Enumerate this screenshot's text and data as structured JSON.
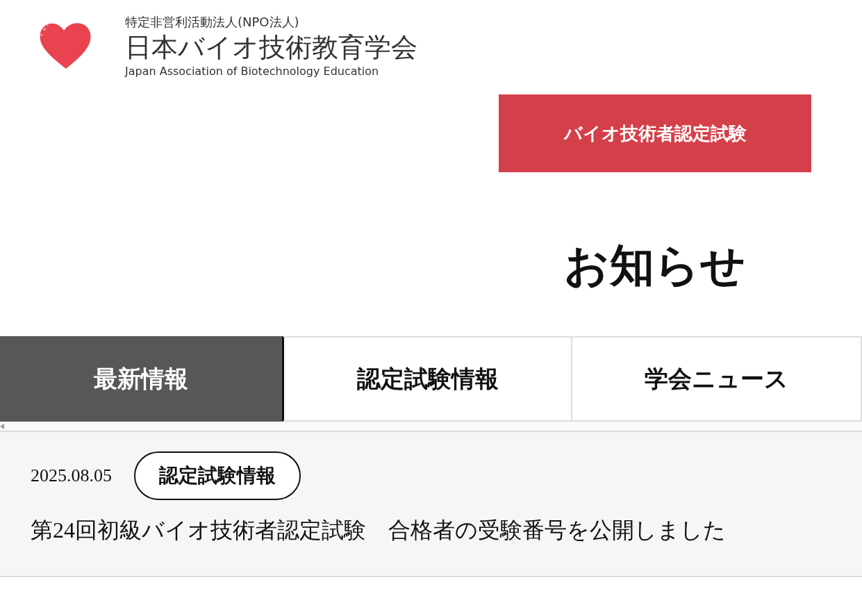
{
  "logo": {
    "subtitle": "特定非営利活動法人(NPO法人)",
    "name": "日本バイオ技術教育学会",
    "english": "Japan Association of Biotechnology Education"
  },
  "exam_button": "バイオ技術者認定試験",
  "heading": "お知らせ",
  "tabs": [
    {
      "label": "最新情報",
      "selected": true
    },
    {
      "label": "認定試験情報",
      "selected": false
    },
    {
      "label": "学会ニュース",
      "selected": false
    }
  ],
  "news": [
    {
      "date": "2025.08.05",
      "tag": "認定試験情報",
      "title": "第24回初級バイオ技術者認定試験　合格者の受験番号を公開しました"
    }
  ]
}
